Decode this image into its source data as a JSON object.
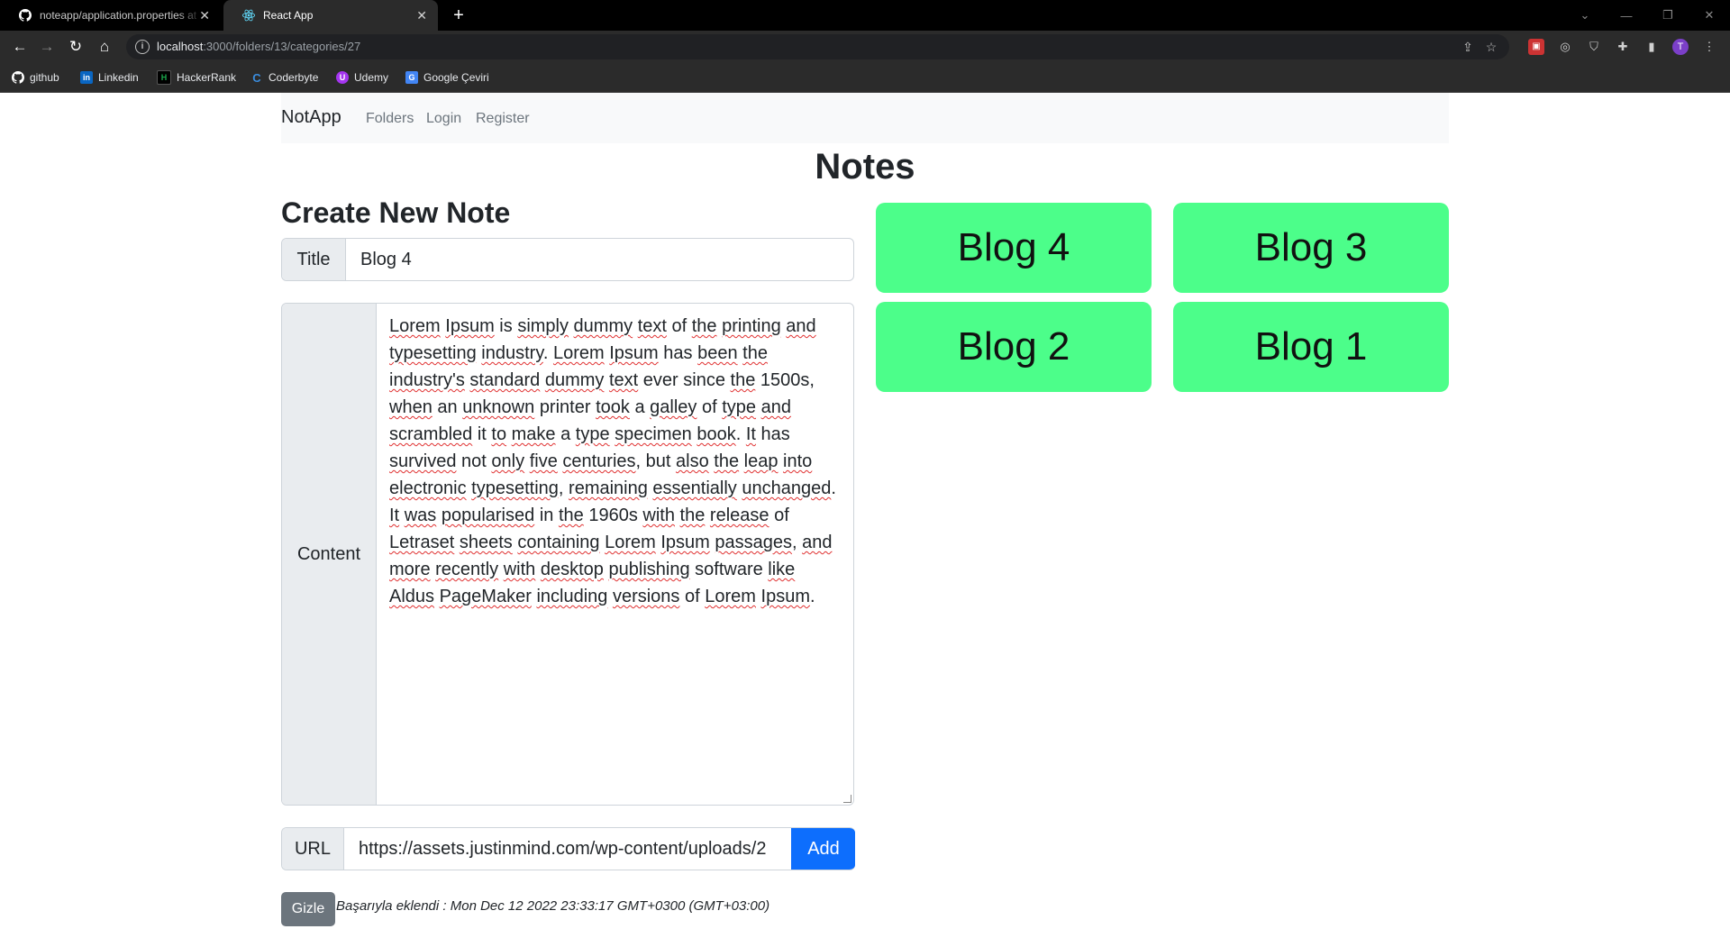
{
  "browser": {
    "tabs": [
      {
        "title": "noteapp/application.properties at",
        "icon": "github-icon"
      },
      {
        "title": "React App",
        "icon": "react-icon"
      }
    ],
    "url_host": "localhost",
    "url_rest": ":3000/folders/13/categories/27",
    "bookmarks": [
      {
        "label": "github",
        "icon": "github-icon",
        "color": "#ffffff"
      },
      {
        "label": "Linkedin",
        "icon": "linkedin-icon",
        "color": "#0a66c2"
      },
      {
        "label": "HackerRank",
        "icon": "hackerrank-icon",
        "color": "#1ba94c"
      },
      {
        "label": "Coderbyte",
        "icon": "coderbyte-icon",
        "color": "#3a8dde"
      },
      {
        "label": "Udemy",
        "icon": "udemy-icon",
        "color": "#a435f0"
      },
      {
        "label": "Google Çeviri",
        "icon": "google-translate-icon",
        "color": "#4285f4"
      }
    ],
    "profile_initial": "T"
  },
  "navbar": {
    "brand": "NotApp",
    "links": [
      "Folders",
      "Login",
      "Register"
    ]
  },
  "page": {
    "heading": "Notes"
  },
  "form": {
    "heading": "Create New Note",
    "title_label": "Title",
    "title_value": "Blog 4",
    "content_label": "Content",
    "content_value": "Lorem Ipsum is simply dummy text of the printing and typesetting industry. Lorem Ipsum has been the industry's standard dummy text ever since the 1500s, when an unknown printer took a galley of type and scrambled it to make a type specimen book. It has survived not only five centuries, but also the leap into electronic typesetting, remaining essentially unchanged. It was popularised in the 1960s with the release of Letraset sheets containing Lorem Ipsum passages, and more recently with desktop publishing software like Aldus PageMaker including versions of Lorem Ipsum.",
    "url_label": "URL",
    "url_value": "https://assets.justinmind.com/wp-content/uploads/2",
    "add_label": "Add",
    "hide_label": "Gizle",
    "status_text": "Başarıyla eklendi : Mon Dec 12 2022 23:33:17 GMT+0300 (GMT+03:00)"
  },
  "notes": [
    "Blog 4",
    "Blog 3",
    "Blog 2",
    "Blog 1"
  ],
  "colors": {
    "card": "#4cfe8a",
    "primary": "#0d6efd",
    "secondary": "#6c757d",
    "navbar_bg": "#f8f9fa"
  }
}
